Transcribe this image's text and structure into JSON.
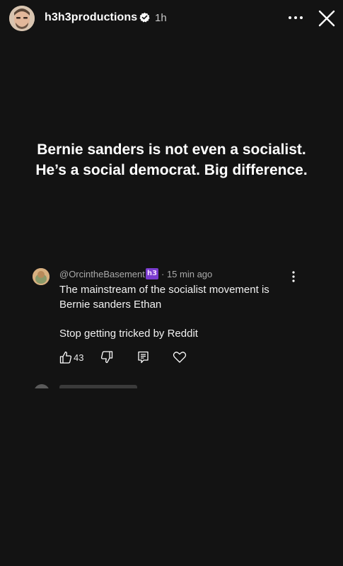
{
  "header": {
    "username": "h3h3productions",
    "time_ago": "1h",
    "icons": {
      "verified": "verified-badge-icon",
      "more": "more-options-icon",
      "close": "close-icon"
    }
  },
  "story": {
    "text_lines": [
      "Bernie sanders is not even a socialist.",
      "He’s a social democrat. Big difference."
    ]
  },
  "comment": {
    "author": "@OrcintheBasement",
    "badge_text": "h3",
    "time_ago": "· 15 min ago",
    "text_lines": [
      "The mainstream of the socialist movement is",
      "Bernie sanders Ethan",
      "",
      "Stop getting tricked by Reddit"
    ],
    "like_count": "43",
    "icons": {
      "like": "thumbs-up-icon",
      "dislike": "thumbs-down-icon",
      "reply": "reply-icon",
      "heart": "heart-icon",
      "menu": "vertical-dots-icon"
    }
  },
  "colors": {
    "background": "#131313",
    "text": "#ffffff",
    "secondary_text": "#aaaaaa",
    "badge": "#7a3ccf"
  }
}
